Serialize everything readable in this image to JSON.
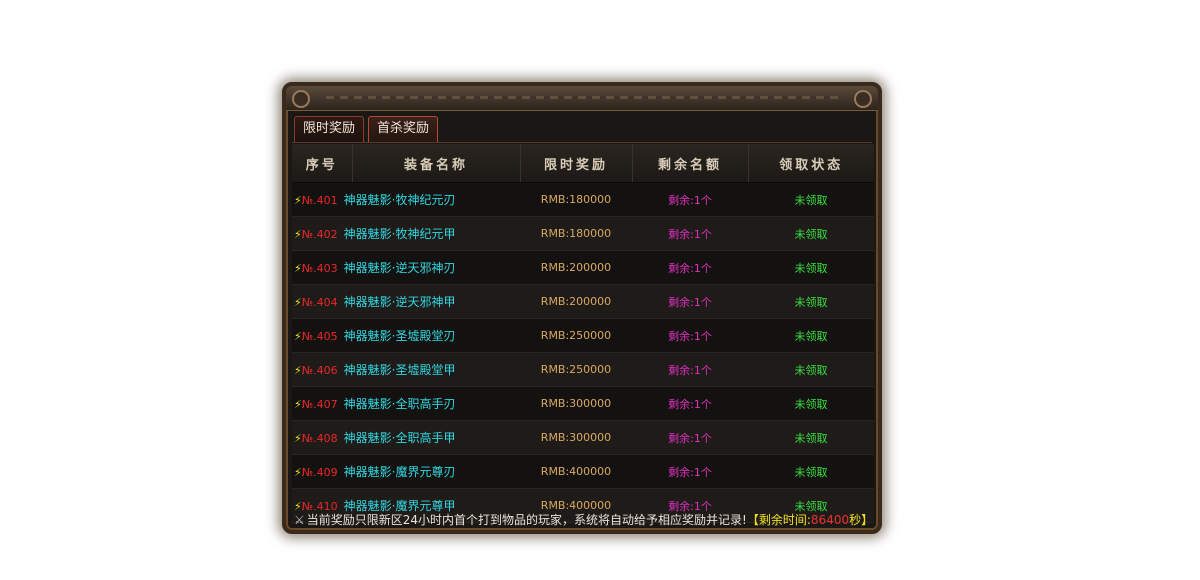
{
  "tabs": [
    {
      "label": "限时奖励",
      "active": false
    },
    {
      "label": "首杀奖励",
      "active": true
    }
  ],
  "table": {
    "headers": [
      "序号",
      "装备名称",
      "限时奖励",
      "剩余名额",
      "领取状态"
    ],
    "rows": [
      {
        "num": "№.401",
        "name": "神器魅影·牧神纪元刃",
        "reward": "RMB:180000",
        "remain": "剩余:1个",
        "status": "未领取"
      },
      {
        "num": "№.402",
        "name": "神器魅影·牧神纪元甲",
        "reward": "RMB:180000",
        "remain": "剩余:1个",
        "status": "未领取"
      },
      {
        "num": "№.403",
        "name": "神器魅影·逆天邪神刃",
        "reward": "RMB:200000",
        "remain": "剩余:1个",
        "status": "未领取"
      },
      {
        "num": "№.404",
        "name": "神器魅影·逆天邪神甲",
        "reward": "RMB:200000",
        "remain": "剩余:1个",
        "status": "未领取"
      },
      {
        "num": "№.405",
        "name": "神器魅影·圣墟殿堂刃",
        "reward": "RMB:250000",
        "remain": "剩余:1个",
        "status": "未领取"
      },
      {
        "num": "№.406",
        "name": "神器魅影·圣墟殿堂甲",
        "reward": "RMB:250000",
        "remain": "剩余:1个",
        "status": "未领取"
      },
      {
        "num": "№.407",
        "name": "神器魅影·全职高手刃",
        "reward": "RMB:300000",
        "remain": "剩余:1个",
        "status": "未领取"
      },
      {
        "num": "№.408",
        "name": "神器魅影·全职高手甲",
        "reward": "RMB:300000",
        "remain": "剩余:1个",
        "status": "未领取"
      },
      {
        "num": "№.409",
        "name": "神器魅影·魔界元尊刃",
        "reward": "RMB:400000",
        "remain": "剩余:1个",
        "status": "未领取"
      },
      {
        "num": "№.410",
        "name": "神器魅影·魔界元尊甲",
        "reward": "RMB:400000",
        "remain": "剩余:1个",
        "status": "未领取"
      }
    ]
  },
  "footer": {
    "notice": "当前奖励只限新区24小时内首个打到物品的玩家，系统将自动给予相应奖励并记录!",
    "bracket_open": "【",
    "timer_label": "剩余时间:",
    "timer_value": "86400",
    "timer_unit": "秒",
    "bracket_close": "】"
  },
  "icons": {
    "row_icon": "lightning-bolt-icon",
    "footer_icon": "crossed-swords-icon"
  },
  "colors": {
    "number": "#e8282a",
    "item_name": "#32d6e0",
    "reward": "#d8a860",
    "remain": "#e030c0",
    "status": "#38e040",
    "timer_value": "#e83030"
  }
}
